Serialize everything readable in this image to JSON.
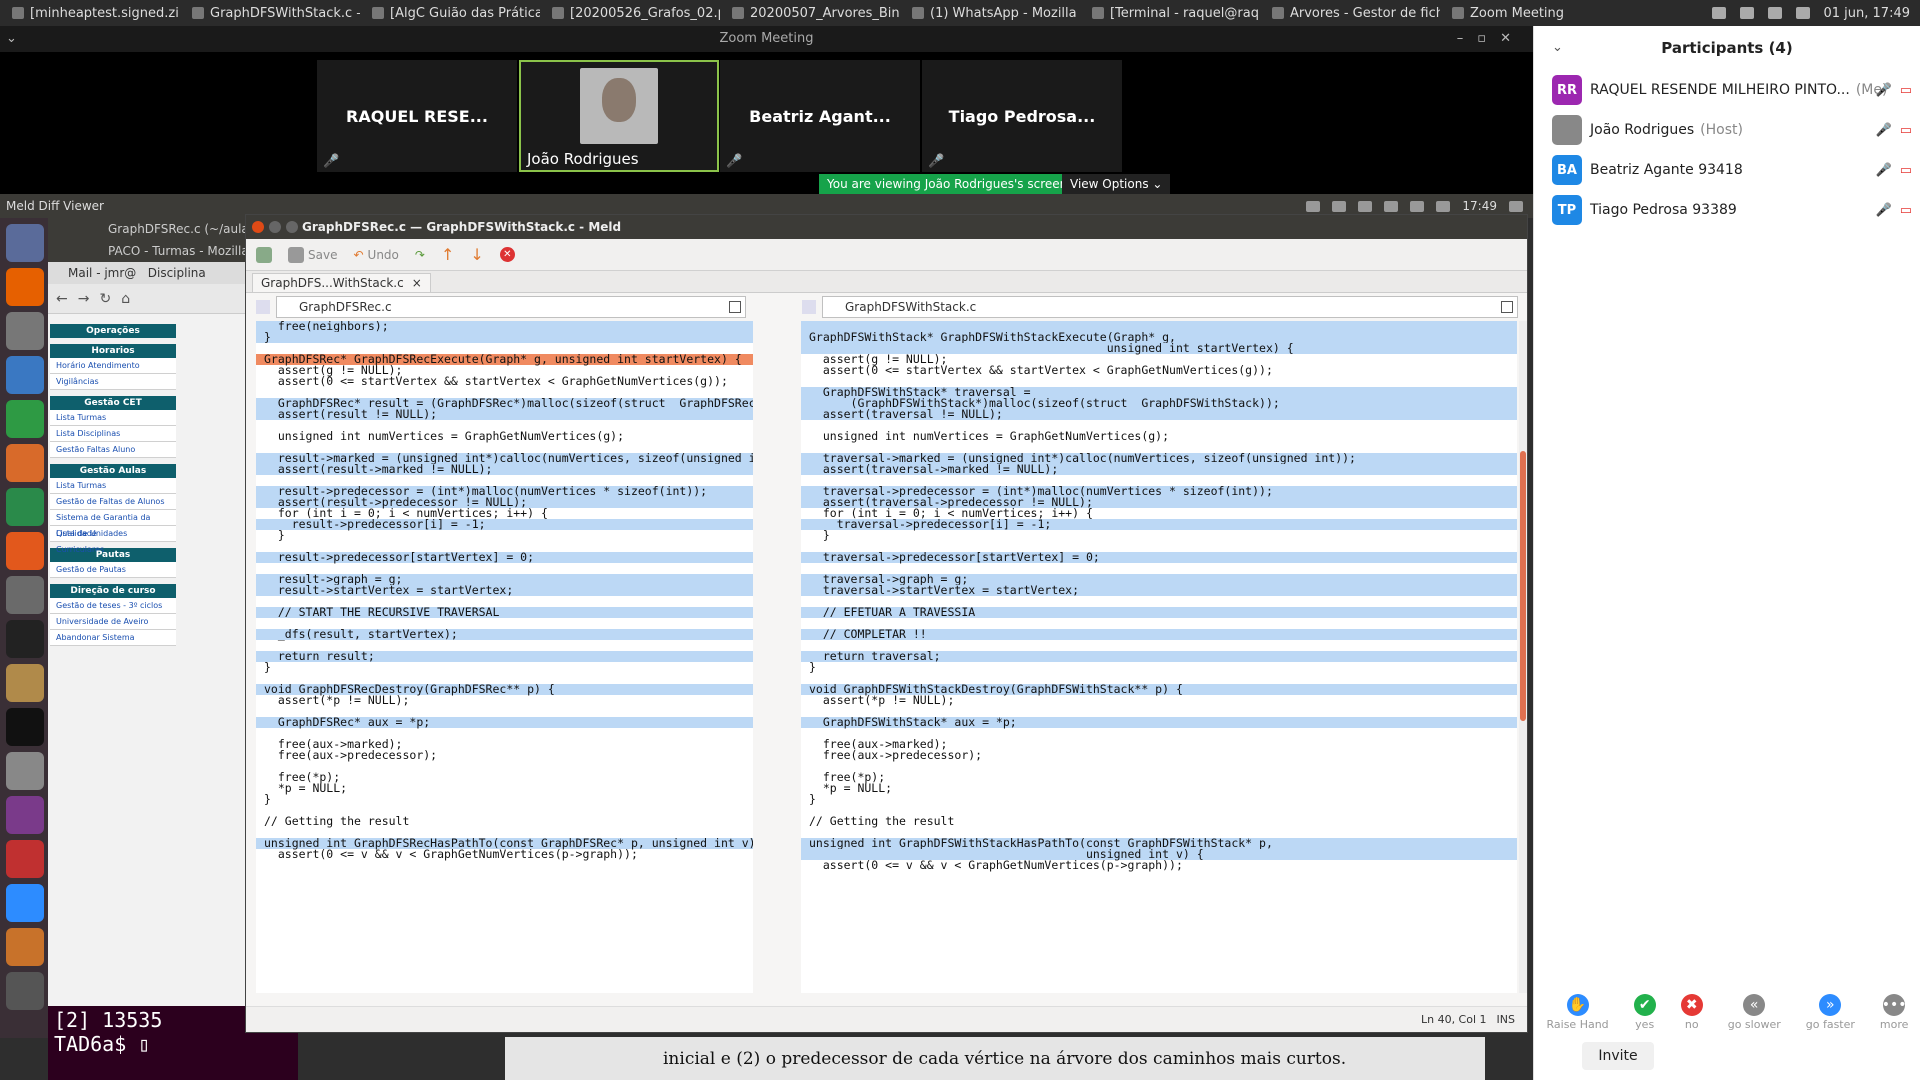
{
  "taskbar": {
    "tabs": [
      "[minheaptest.signed.zip]",
      "GraphDFSWithStack.c —...",
      "[AlgC Guião das Práticas...",
      "[20200526_Grafos_02.p...",
      "20200507_Arvores_Bina...",
      "(1) WhatsApp - Mozilla Fi...",
      "[Terminal - raquel@raqu...",
      "Arvores - Gestor de fich...",
      "Zoom Meeting"
    ],
    "datetime": "01 jun, 17:49"
  },
  "zoom": {
    "window_title": "Zoom Meeting",
    "tiles": [
      {
        "name": "RAQUEL RESE..."
      },
      {
        "name": "João Rodrigues"
      },
      {
        "name": "Beatriz Agant..."
      },
      {
        "name": "Tiago Pedrosa..."
      }
    ],
    "viewing_banner": "You are viewing João Rodrigues's screen",
    "view_options": "View Options"
  },
  "remote": {
    "app_title": "Meld Diff Viewer",
    "time": "17:49",
    "bg_window_title": "GraphDFSRec.c (~/aula...",
    "browser_title": "PACO - Turmas - Mozilla",
    "browser_tabs": [
      "Mail - jmr@",
      "Disciplina"
    ],
    "paco_sections": [
      {
        "head": "Operações",
        "items": []
      },
      {
        "head": "Horarios",
        "items": [
          "Horário Atendimento",
          "Vigilâncias"
        ]
      },
      {
        "head": "Gestão CET",
        "items": [
          "Lista Turmas",
          "Lista Disciplinas",
          "Gestão Faltas Aluno"
        ]
      },
      {
        "head": "Gestão Aulas",
        "items": [
          "Lista Turmas",
          "Gestão de Faltas de Alunos",
          "Sistema de Garantia da Qualidade",
          "Lista de Unidades Curriculares"
        ]
      },
      {
        "head": "Pautas",
        "items": [
          "Gestão de Pautas"
        ]
      },
      {
        "head": "Direção de curso",
        "items": [
          "Gestão de teses - 3º ciclos",
          "Universidade de Aveiro",
          "Abandonar Sistema"
        ]
      }
    ],
    "terminal_lines": [
      "[2] 13535",
      "TAD6a$"
    ],
    "bottom_doc_text": "inicial e (2) o predecessor de cada vértice na árvore dos caminhos mais curtos."
  },
  "meld": {
    "title": "GraphDFSRec.c — GraphDFSWithStack.c - Meld",
    "toolbar": {
      "save": "Save",
      "undo": "Undo"
    },
    "tab": "GraphDFS...WithStack.c",
    "left_file": "GraphDFSRec.c",
    "right_file": "GraphDFSWithStack.c",
    "status": {
      "position": "Ln 40, Col 1",
      "mode": "INS"
    },
    "left_lines": [
      {
        "t": "  free(neighbors);",
        "k": "e"
      },
      {
        "t": "}",
        "k": "c"
      },
      {
        "t": "",
        "k": ""
      },
      {
        "t": "GraphDFSRec* GraphDFSRecExecute(Graph* g, unsigned int startVertex) {",
        "k": "d"
      },
      {
        "t": "  assert(g != NULL);",
        "k": ""
      },
      {
        "t": "  assert(0 <= startVertex && startVertex < GraphGetNumVertices(g));",
        "k": ""
      },
      {
        "t": "",
        "k": ""
      },
      {
        "t": "  GraphDFSRec* result = (GraphDFSRec*)malloc(sizeof(struct _GraphDFSRec));",
        "k": "c"
      },
      {
        "t": "  assert(result != NULL);",
        "k": "c"
      },
      {
        "t": "",
        "k": ""
      },
      {
        "t": "  unsigned int numVertices = GraphGetNumVertices(g);",
        "k": ""
      },
      {
        "t": "",
        "k": ""
      },
      {
        "t": "  result->marked = (unsigned int*)calloc(numVertices, sizeof(unsigned int));",
        "k": "c"
      },
      {
        "t": "  assert(result->marked != NULL);",
        "k": "c"
      },
      {
        "t": "",
        "k": ""
      },
      {
        "t": "  result->predecessor = (int*)malloc(numVertices * sizeof(int));",
        "k": "c"
      },
      {
        "t": "  assert(result->predecessor != NULL);",
        "k": "c"
      },
      {
        "t": "  for (int i = 0; i < numVertices; i++) {",
        "k": ""
      },
      {
        "t": "    result->predecessor[i] = -1;",
        "k": "c"
      },
      {
        "t": "  }",
        "k": ""
      },
      {
        "t": "",
        "k": ""
      },
      {
        "t": "  result->predecessor[startVertex] = 0;",
        "k": "c"
      },
      {
        "t": "",
        "k": ""
      },
      {
        "t": "  result->graph = g;",
        "k": "c"
      },
      {
        "t": "  result->startVertex = startVertex;",
        "k": "c"
      },
      {
        "t": "",
        "k": ""
      },
      {
        "t": "  // START THE RECURSIVE TRAVERSAL",
        "k": "c"
      },
      {
        "t": "",
        "k": ""
      },
      {
        "t": "  _dfs(result, startVertex);",
        "k": "c"
      },
      {
        "t": "",
        "k": ""
      },
      {
        "t": "  return result;",
        "k": "c"
      },
      {
        "t": "}",
        "k": ""
      },
      {
        "t": "",
        "k": ""
      },
      {
        "t": "void GraphDFSRecDestroy(GraphDFSRec** p) {",
        "k": "c"
      },
      {
        "t": "  assert(*p != NULL);",
        "k": ""
      },
      {
        "t": "",
        "k": ""
      },
      {
        "t": "  GraphDFSRec* aux = *p;",
        "k": "c"
      },
      {
        "t": "",
        "k": ""
      },
      {
        "t": "  free(aux->marked);",
        "k": ""
      },
      {
        "t": "  free(aux->predecessor);",
        "k": ""
      },
      {
        "t": "",
        "k": ""
      },
      {
        "t": "  free(*p);",
        "k": ""
      },
      {
        "t": "  *p = NULL;",
        "k": ""
      },
      {
        "t": "}",
        "k": ""
      },
      {
        "t": "",
        "k": ""
      },
      {
        "t": "// Getting the result",
        "k": ""
      },
      {
        "t": "",
        "k": ""
      },
      {
        "t": "unsigned int GraphDFSRecHasPathTo(const GraphDFSRec* p, unsigned int v) {",
        "k": "c"
      },
      {
        "t": "  assert(0 <= v && v < GraphGetNumVertices(p->graph));",
        "k": ""
      }
    ],
    "right_lines": [
      {
        "t": "",
        "k": "e"
      },
      {
        "t": "GraphDFSWithStack* GraphDFSWithStackExecute(Graph* g,",
        "k": "c"
      },
      {
        "t": "                                           unsigned int startVertex) {",
        "k": "c"
      },
      {
        "t": "  assert(g != NULL);",
        "k": ""
      },
      {
        "t": "  assert(0 <= startVertex && startVertex < GraphGetNumVertices(g));",
        "k": ""
      },
      {
        "t": "",
        "k": ""
      },
      {
        "t": "  GraphDFSWithStack* traversal =",
        "k": "c"
      },
      {
        "t": "      (GraphDFSWithStack*)malloc(sizeof(struct _GraphDFSWithStack));",
        "k": "c"
      },
      {
        "t": "  assert(traversal != NULL);",
        "k": "c"
      },
      {
        "t": "",
        "k": ""
      },
      {
        "t": "  unsigned int numVertices = GraphGetNumVertices(g);",
        "k": ""
      },
      {
        "t": "",
        "k": ""
      },
      {
        "t": "  traversal->marked = (unsigned int*)calloc(numVertices, sizeof(unsigned int));",
        "k": "c"
      },
      {
        "t": "  assert(traversal->marked != NULL);",
        "k": "c"
      },
      {
        "t": "",
        "k": ""
      },
      {
        "t": "  traversal->predecessor = (int*)malloc(numVertices * sizeof(int));",
        "k": "c"
      },
      {
        "t": "  assert(traversal->predecessor != NULL);",
        "k": "c"
      },
      {
        "t": "  for (int i = 0; i < numVertices; i++) {",
        "k": ""
      },
      {
        "t": "    traversal->predecessor[i] = -1;",
        "k": "c"
      },
      {
        "t": "  }",
        "k": ""
      },
      {
        "t": "",
        "k": ""
      },
      {
        "t": "  traversal->predecessor[startVertex] = 0;",
        "k": "c"
      },
      {
        "t": "",
        "k": ""
      },
      {
        "t": "  traversal->graph = g;",
        "k": "c"
      },
      {
        "t": "  traversal->startVertex = startVertex;",
        "k": "c"
      },
      {
        "t": "",
        "k": ""
      },
      {
        "t": "  // EFETUAR A TRAVESSIA",
        "k": "c"
      },
      {
        "t": "",
        "k": ""
      },
      {
        "t": "  // COMPLETAR !!",
        "k": "c"
      },
      {
        "t": "",
        "k": ""
      },
      {
        "t": "  return traversal;",
        "k": "c"
      },
      {
        "t": "}",
        "k": ""
      },
      {
        "t": "",
        "k": ""
      },
      {
        "t": "void GraphDFSWithStackDestroy(GraphDFSWithStack** p) {",
        "k": "c"
      },
      {
        "t": "  assert(*p != NULL);",
        "k": ""
      },
      {
        "t": "",
        "k": ""
      },
      {
        "t": "  GraphDFSWithStack* aux = *p;",
        "k": "c"
      },
      {
        "t": "",
        "k": ""
      },
      {
        "t": "  free(aux->marked);",
        "k": ""
      },
      {
        "t": "  free(aux->predecessor);",
        "k": ""
      },
      {
        "t": "",
        "k": ""
      },
      {
        "t": "  free(*p);",
        "k": ""
      },
      {
        "t": "  *p = NULL;",
        "k": ""
      },
      {
        "t": "}",
        "k": ""
      },
      {
        "t": "",
        "k": ""
      },
      {
        "t": "// Getting the result",
        "k": ""
      },
      {
        "t": "",
        "k": ""
      },
      {
        "t": "unsigned int GraphDFSWithStackHasPathTo(const GraphDFSWithStack* p,",
        "k": "c"
      },
      {
        "t": "                                        unsigned int v) {",
        "k": "c"
      },
      {
        "t": "  assert(0 <= v && v < GraphGetNumVertices(p->graph));",
        "k": ""
      }
    ]
  },
  "participants": {
    "title": "Participants (4)",
    "list": [
      {
        "initials": "RR",
        "name": "RAQUEL RESENDE MILHEIRO PINTO...",
        "role": "(Me)",
        "color": "#9c27b0"
      },
      {
        "initials": "",
        "name": "João Rodrigues",
        "role": "(Host)",
        "color": "#888888"
      },
      {
        "initials": "BA",
        "name": "Beatriz Agante 93418",
        "role": "",
        "color": "#1e88e5"
      },
      {
        "initials": "TP",
        "name": "Tiago Pedrosa 93389",
        "role": "",
        "color": "#1e88e5"
      }
    ],
    "reactions": [
      {
        "label": "Raise Hand",
        "glyph": "✋",
        "color": "#2d8cff"
      },
      {
        "label": "yes",
        "glyph": "✔",
        "color": "#22b14c"
      },
      {
        "label": "no",
        "glyph": "✖",
        "color": "#e53935"
      },
      {
        "label": "go slower",
        "glyph": "«",
        "color": "#888888"
      },
      {
        "label": "go faster",
        "glyph": "»",
        "color": "#2d8cff"
      },
      {
        "label": "more",
        "glyph": "•••",
        "color": "#888888"
      }
    ],
    "invite": "Invite"
  }
}
